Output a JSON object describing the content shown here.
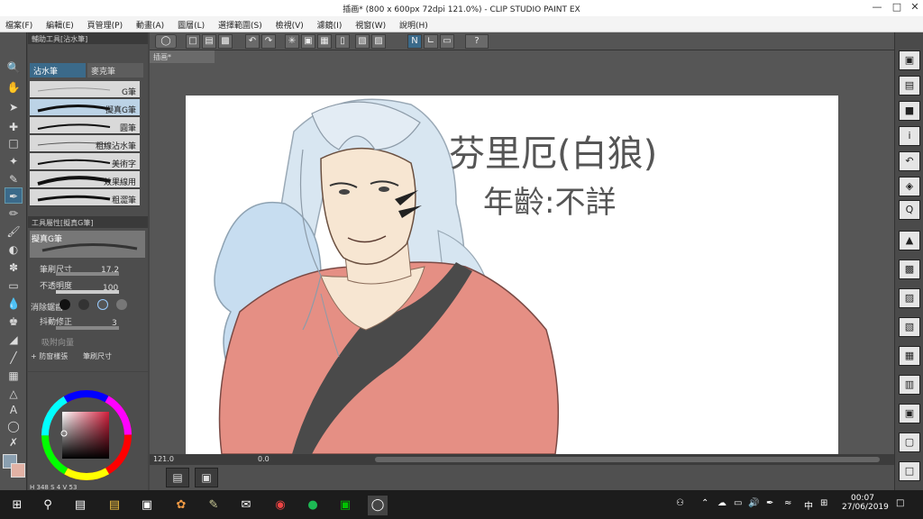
{
  "window": {
    "title": "插画* (800 x 600px 72dpi 121.0%) - CLIP STUDIO PAINT EX"
  },
  "menu": [
    "檔案(F)",
    "編輯(E)",
    "頁管理(P)",
    "動畫(A)",
    "圖層(L)",
    "選擇範圍(S)",
    "檢視(V)",
    "濾鏡(I)",
    "視窗(W)",
    "說明(H)"
  ],
  "subtool": {
    "panel_title": "輔助工具[沾水筆]",
    "tabs": [
      "沾水筆",
      "麥克筆"
    ],
    "brushes": [
      "G筆",
      "擬真G筆",
      "圓筆",
      "粗線沾水筆",
      "美術字",
      "效果線用",
      "粗澀筆"
    ]
  },
  "tool_property": {
    "panel_title": "工具屬性[擬真G筆]",
    "preset_name": "擬真G筆",
    "brush_size_label": "筆刷尺寸",
    "brush_size_value": "17.2",
    "opacity_label": "不透明度",
    "opacity_value": "100",
    "anti_alias_label": "消除鋸齒",
    "stabilize_label": "抖動修正",
    "stabilize_value": "3",
    "vector_label": "吸附向量",
    "shortcut_left": "+ 防窗樣張",
    "shortcut_right": "筆刷尺寸"
  },
  "color": {
    "main": "#8a9fb0",
    "sub": "#e2b2a5",
    "hsv": {
      "H": "348",
      "S": "4",
      "V": "53"
    }
  },
  "canvas": {
    "tab_label": "插画*",
    "handwriting_line1": "芬里厄(白狼)",
    "handwriting_line2": "年齡:不詳"
  },
  "status": {
    "zoom": "121.0",
    "angle": "0.0"
  },
  "taskbar": {
    "time": "00:07",
    "date": "27/06/2019",
    "ime": "中"
  },
  "colors": {
    "robe": "#e58f84",
    "collar": "#4a4a4a",
    "fur": "#cbe0f2",
    "skin": "#f7e6d2",
    "accent": "#3b6a8a"
  }
}
